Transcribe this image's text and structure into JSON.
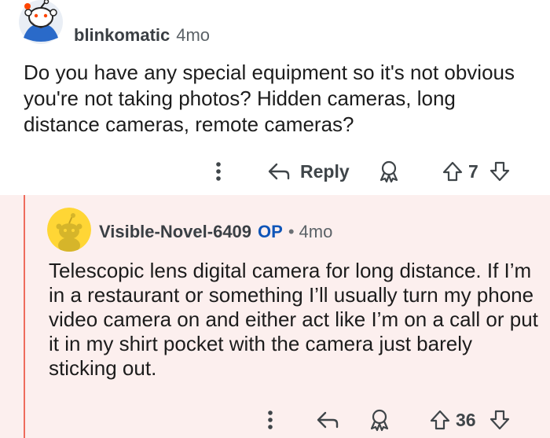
{
  "parent_comment": {
    "username": "blinkomatic",
    "age": "4mo",
    "body": "Do you have any special equipment so it's not obvious you're not taking photos? Hidden cameras, long distance cameras, remote cameras?",
    "reply_label": "Reply",
    "vote_count": "7",
    "icons": [
      "more-options-icon",
      "reply-arrow-icon",
      "award-icon",
      "upvote-icon",
      "downvote-icon"
    ]
  },
  "reply_comment": {
    "username": "Visible-Novel-6409",
    "op_badge": "OP",
    "separator": "•",
    "age": "4mo",
    "body": "Telescopic lens digital camera for long distance. If I’m in a restaurant or something I’ll usually turn my phone video camera on and either act like I’m on a call or put it in my shirt pocket with the camera just barely sticking out.",
    "vote_count": "36",
    "icons": [
      "more-options-icon",
      "reply-arrow-icon",
      "award-icon",
      "upvote-icon",
      "downvote-icon"
    ]
  },
  "colors": {
    "thread_line": "#ee6c5c",
    "reply_background": "#fcefee",
    "op_badge": "#0f55b8"
  }
}
